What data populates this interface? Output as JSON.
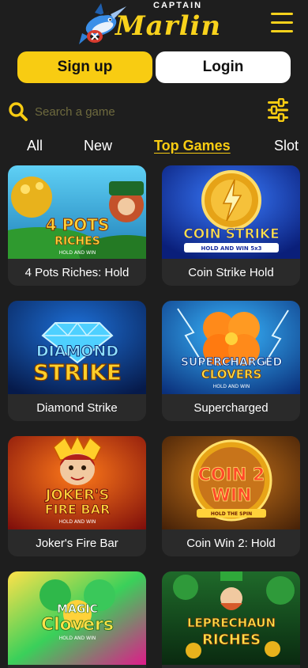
{
  "header": {
    "logo_top": "CAPTAIN",
    "logo_main": "Marlin"
  },
  "auth": {
    "signup_label": "Sign up",
    "login_label": "Login"
  },
  "search": {
    "placeholder": "Search a game"
  },
  "tabs": [
    "All",
    "New",
    "Top Games",
    "Slot"
  ],
  "active_tab": "Top Games",
  "games": [
    {
      "title": "4 Pots Riches: Hold",
      "art_line1": "4 POTS",
      "art_line2": "RICHES",
      "art_sub": "HOLD AND WIN"
    },
    {
      "title": "Coin Strike Hold",
      "art_line1": "COIN STRIKE",
      "art_line2": "",
      "art_sub": "HOLD AND WIN 5x3"
    },
    {
      "title": "Diamond Strike",
      "art_line1": "DIAMOND",
      "art_line2": "STRIKE",
      "art_sub": ""
    },
    {
      "title": "Supercharged",
      "art_line1": "SUPERCHARGED",
      "art_line2": "CLOVERS",
      "art_sub": "HOLD AND WIN"
    },
    {
      "title": "Joker's Fire Bar",
      "art_line1": "JOKER'S",
      "art_line2": "FIRE BAR",
      "art_sub": "HOLD AND WIN"
    },
    {
      "title": "Coin Win 2: Hold",
      "art_line1": "COIN 2",
      "art_line2": "WIN",
      "art_sub": "HOLD THE SPIN"
    },
    {
      "title": "",
      "art_line1": "MAGIC",
      "art_line2": "Clovers",
      "art_sub": "HOLD AND WIN"
    },
    {
      "title": "",
      "art_line1": "LEPRECHAUN",
      "art_line2": "RICHES",
      "art_sub": ""
    }
  ],
  "colors": {
    "accent": "#f8cc12",
    "background": "#1e1e1e",
    "card": "#2a2a2a"
  },
  "icons": {
    "menu": "hamburger-menu-icon",
    "search": "search-icon",
    "filter": "filter-sliders-icon"
  }
}
